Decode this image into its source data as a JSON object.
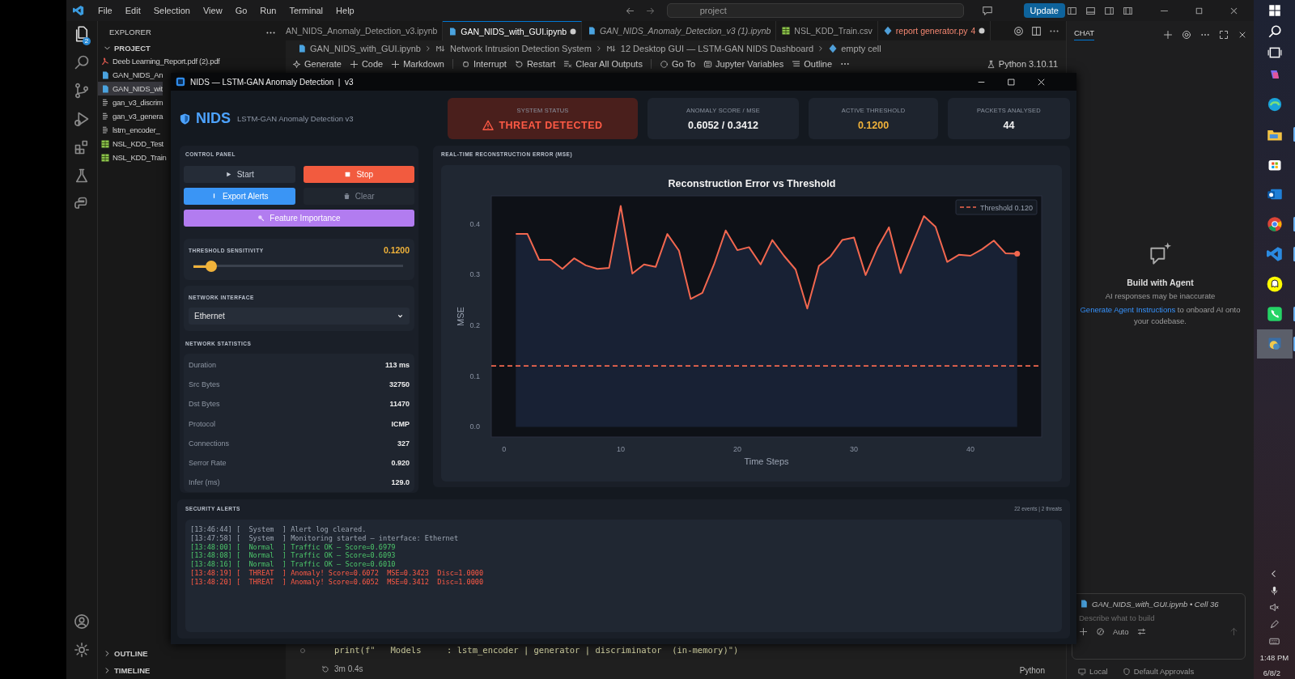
{
  "ide": {
    "menu": [
      "File",
      "Edit",
      "Selection",
      "View",
      "Go",
      "Run",
      "Terminal",
      "Help"
    ],
    "command_center": "project",
    "update_button": "Update",
    "explorer_badge": "2",
    "explorer": {
      "title": "EXPLORER",
      "section": "PROJECT",
      "files": [
        {
          "name": "Deeb Learning_Report.pdf (2).pdf",
          "kind": "pdf",
          "selected": false
        },
        {
          "name": "GAN_NIDS_An",
          "kind": "notebook",
          "selected": false
        },
        {
          "name": "GAN_NIDS_wit",
          "kind": "notebook",
          "selected": true
        },
        {
          "name": "gan_v3_discrim",
          "kind": "model",
          "selected": false
        },
        {
          "name": "gan_v3_genera",
          "kind": "model",
          "selected": false
        },
        {
          "name": "lstm_encoder_",
          "kind": "model",
          "selected": false
        },
        {
          "name": "NSL_KDD_Test",
          "kind": "csv",
          "selected": false
        },
        {
          "name": "NSL_KDD_Train",
          "kind": "csv",
          "selected": false
        }
      ]
    },
    "bottom_sections": [
      "OUTLINE",
      "TIMELINE"
    ],
    "tabs": [
      {
        "label": "AN_NIDS_Anomaly_Detection_v3.ipynb",
        "selected": false,
        "preview": false,
        "modified": false
      },
      {
        "label": "GAN_NIDS_with_GUI.ipynb",
        "kind": "notebook",
        "selected": true,
        "preview": false,
        "modified": true
      },
      {
        "label": "GAN_NIDS_Anomaly_Detection_v3 (1).ipynb",
        "kind": "notebook",
        "selected": false,
        "preview": true,
        "modified": false
      },
      {
        "label": "NSL_KDD_Train.csv",
        "kind": "csv",
        "selected": false,
        "preview": false,
        "modified": false
      },
      {
        "label": "report generator.py",
        "kind": "python",
        "selected": false,
        "preview": false,
        "modified": true,
        "problems": "4"
      }
    ],
    "breadcrumbs": [
      {
        "text": "GAN_NIDS_with_GUI.ipynb",
        "kind": "notebook"
      },
      {
        "text": "Network Intrusion Detection System",
        "kind": "markdown"
      },
      {
        "text": "12 Desktop GUI — LSTM-GAN NIDS Dashboard",
        "kind": "markdown"
      },
      {
        "text": "empty cell",
        "kind": "cell"
      }
    ],
    "notebook_toolbar": [
      {
        "label": "Generate",
        "kind": "sparkle"
      },
      {
        "label": "Code",
        "kind": "plus"
      },
      {
        "label": "Markdown",
        "kind": "plus"
      },
      {
        "label": "Interrupt",
        "kind": "stop"
      },
      {
        "label": "Restart",
        "kind": "restart"
      },
      {
        "label": "Clear All Outputs",
        "kind": "clear"
      },
      {
        "label": "Go To",
        "kind": "goto"
      },
      {
        "label": "Jupyter Variables",
        "kind": "variables"
      },
      {
        "label": "Outline",
        "kind": "outline"
      }
    ],
    "kernel": "Python 3.10.11",
    "code_line": "print(f\"   Models     : lstm_encoder | generator | discriminator  (in-memory)\")",
    "exec_time": "3m 0.4s",
    "cell_language": "Python",
    "chat": {
      "title": "CHAT",
      "heading": "Build with Agent",
      "notice": "AI responses may be inaccurate",
      "link": "Generate Agent Instructions",
      "after_link": "to onboard AI onto your codebase.",
      "context": "GAN_NIDS_with_GUI.ipynb • Cell 36",
      "placeholder": "Describe what to build",
      "mode": "Auto",
      "location": "Local",
      "approvals": "Default Approvals"
    }
  },
  "taskbar": {
    "apps": [
      {
        "kind": "copilot",
        "running": false,
        "selected": false
      },
      {
        "kind": "edge",
        "running": false,
        "selected": false
      },
      {
        "kind": "folder",
        "running": true,
        "selected": false
      },
      {
        "kind": "store",
        "running": false,
        "selected": false
      },
      {
        "kind": "mail",
        "running": false,
        "selected": false
      },
      {
        "kind": "browser",
        "running": true,
        "selected": false
      },
      {
        "kind": "code",
        "running": true,
        "selected": false
      },
      {
        "kind": "ghost",
        "running": false,
        "selected": false
      },
      {
        "kind": "phone",
        "running": true,
        "selected": false
      },
      {
        "kind": "python",
        "running": true,
        "selected": true
      }
    ],
    "time": "1:48 PM",
    "date": "6/8/2"
  },
  "nids": {
    "title": "NIDS — LSTM-GAN Anomaly Detection  |  v3",
    "logo": "NIDS",
    "subtitle": "LSTM-GAN Anomaly Detection v3",
    "cards": [
      {
        "label": "SYSTEM STATUS",
        "value": "THREAT DETECTED",
        "kind": "alert"
      },
      {
        "label": "ANOMALY SCORE / MSE",
        "value": "0.6052 / 0.3412",
        "kind": "plain"
      },
      {
        "label": "ACTIVE THRESHOLD",
        "value": "0.1200",
        "kind": "accent"
      },
      {
        "label": "PACKETS ANALYSED",
        "value": "44",
        "kind": "plain"
      }
    ],
    "control_panel": {
      "title": "CONTROL PANEL",
      "buttons": [
        {
          "label": "Start",
          "kind": "start"
        },
        {
          "label": "Stop",
          "kind": "stop"
        },
        {
          "label": "Export Alerts",
          "kind": "export"
        },
        {
          "label": "Clear",
          "kind": "clear"
        },
        {
          "label": "Feature Importance",
          "kind": "feature"
        }
      ],
      "threshold": {
        "label": "THRESHOLD SENSITIVITY",
        "value": "0.1200",
        "level": 0.085
      },
      "interface": {
        "label": "NETWORK INTERFACE",
        "value": "Ethernet"
      },
      "stats_title": "NETWORK STATISTICS",
      "stats": [
        {
          "label": "Duration",
          "value": "113 ms"
        },
        {
          "label": "Src Bytes",
          "value": "32750"
        },
        {
          "label": "Dst Bytes",
          "value": "11470"
        },
        {
          "label": "Protocol",
          "value": "ICMP"
        },
        {
          "label": "Connections",
          "value": "327"
        },
        {
          "label": "Serror Rate",
          "value": "0.920"
        },
        {
          "label": "Infer (ms)",
          "value": "129.0"
        }
      ]
    },
    "chart_panel": {
      "title": "REAL-TIME RECONSTRUCTION ERROR (MSE)",
      "chart_data": {
        "type": "area",
        "title": "Reconstruction Error vs Threshold",
        "xlabel": "Time Steps",
        "ylabel": "MSE",
        "x": [
          1,
          2,
          3,
          4,
          5,
          6,
          7,
          8,
          9,
          10,
          11,
          12,
          13,
          14,
          15,
          16,
          17,
          18,
          19,
          20,
          21,
          22,
          23,
          24,
          25,
          26,
          27,
          28,
          29,
          30,
          31,
          32,
          33,
          34,
          35,
          36,
          37,
          38,
          39,
          40,
          41,
          42,
          43,
          44
        ],
        "series": [
          {
            "color": "#f2674f",
            "values": [
              0.38,
              0.38,
              0.329,
              0.329,
              0.311,
              0.332,
              0.318,
              0.311,
              0.313,
              0.435,
              0.302,
              0.32,
              0.315,
              0.38,
              0.347,
              0.252,
              0.264,
              0.32,
              0.387,
              0.348,
              0.354,
              0.32,
              0.368,
              0.337,
              0.31,
              0.233,
              0.317,
              0.336,
              0.368,
              0.373,
              0.299,
              0.352,
              0.393,
              0.303,
              0.359,
              0.415,
              0.394,
              0.325,
              0.339,
              0.337,
              0.35,
              0.367,
              0.342,
              0.341
            ]
          }
        ],
        "xlim": [
          -1.1,
          46.1
        ],
        "ylim": [
          -0.02,
          0.455
        ],
        "xticks": [
          0,
          10,
          20,
          30,
          40
        ],
        "yticks": [
          {
            "value": 0,
            "label": "0.0"
          },
          {
            "value": 0.1,
            "label": "0.1"
          },
          {
            "value": 0.2,
            "label": "0.2"
          },
          {
            "value": 0.3,
            "label": "0.3"
          },
          {
            "value": 0.4,
            "label": "0.4"
          }
        ],
        "ref_lines": [
          {
            "axis": "y",
            "value": 0.12,
            "label": "Threshold 0.120",
            "color": "#f2674f"
          }
        ]
      }
    },
    "alerts": {
      "title": "SECURITY ALERTS",
      "summary": "22 events | 2 threats",
      "log": [
        {
          "text": "[13:46:44] [  System  ] Alert log cleared.",
          "kind": "system"
        },
        {
          "text": "[13:47:58] [  System  ] Monitoring started — interface: Ethernet",
          "kind": "system"
        },
        {
          "text": "[13:48:00] [  Normal  ] Traffic OK — Score=0.6979",
          "kind": "normal"
        },
        {
          "text": "[13:48:08] [  Normal  ] Traffic OK — Score=0.6093",
          "kind": "normal"
        },
        {
          "text": "[13:48:16] [  Normal  ] Traffic OK — Score=0.6010",
          "kind": "normal"
        },
        {
          "text": "[13:48:19] [  THREAT  ] Anomaly! Score=0.6072  MSE=0.3423  Disc=1.0000",
          "kind": "threat"
        },
        {
          "text": "[13:48:20] [  THREAT  ] Anomaly! Score=0.6052  MSE=0.3412  Disc=1.0000",
          "kind": "threat"
        }
      ]
    }
  }
}
